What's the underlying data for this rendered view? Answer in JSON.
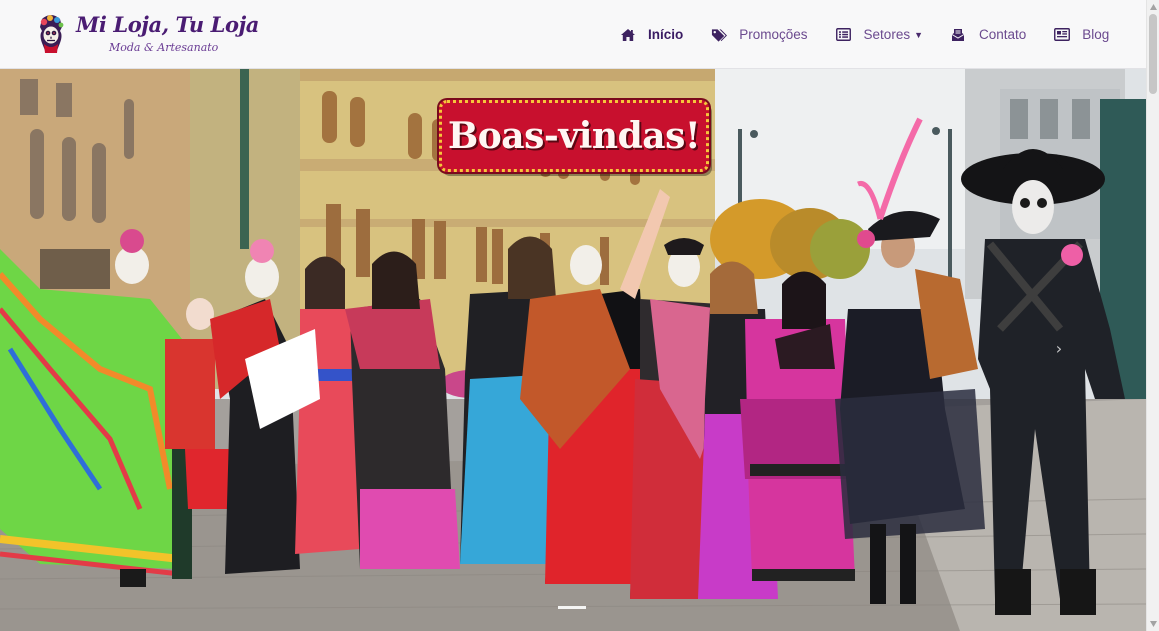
{
  "brand": {
    "title": "Mi Loja, Tu Loja",
    "subtitle": "Moda & Artesanato",
    "logo_icon": "catrina-skull-logo"
  },
  "nav": {
    "items": [
      {
        "label": "Início",
        "icon": "home-icon",
        "active": true
      },
      {
        "label": "Promoções",
        "icon": "tags-icon",
        "active": false
      },
      {
        "label": "Setores",
        "icon": "list-icon",
        "active": false,
        "dropdown": true
      },
      {
        "label": "Contato",
        "icon": "envelope-icon",
        "active": false
      },
      {
        "label": "Blog",
        "icon": "newspaper-icon",
        "active": false
      }
    ]
  },
  "hero": {
    "welcome_text": "Boas-vindas!",
    "image_description_icon": "day-of-the-dead-parade-photo",
    "slide_indicator_active": 1,
    "next_control": "chevron-right-icon"
  },
  "colors": {
    "brand_purple": "#4a1c73",
    "nav_text": "#6b4a8f",
    "badge_red": "#c8102e",
    "badge_gold": "#f5c63b",
    "navbar_bg": "#f8f8f9"
  }
}
